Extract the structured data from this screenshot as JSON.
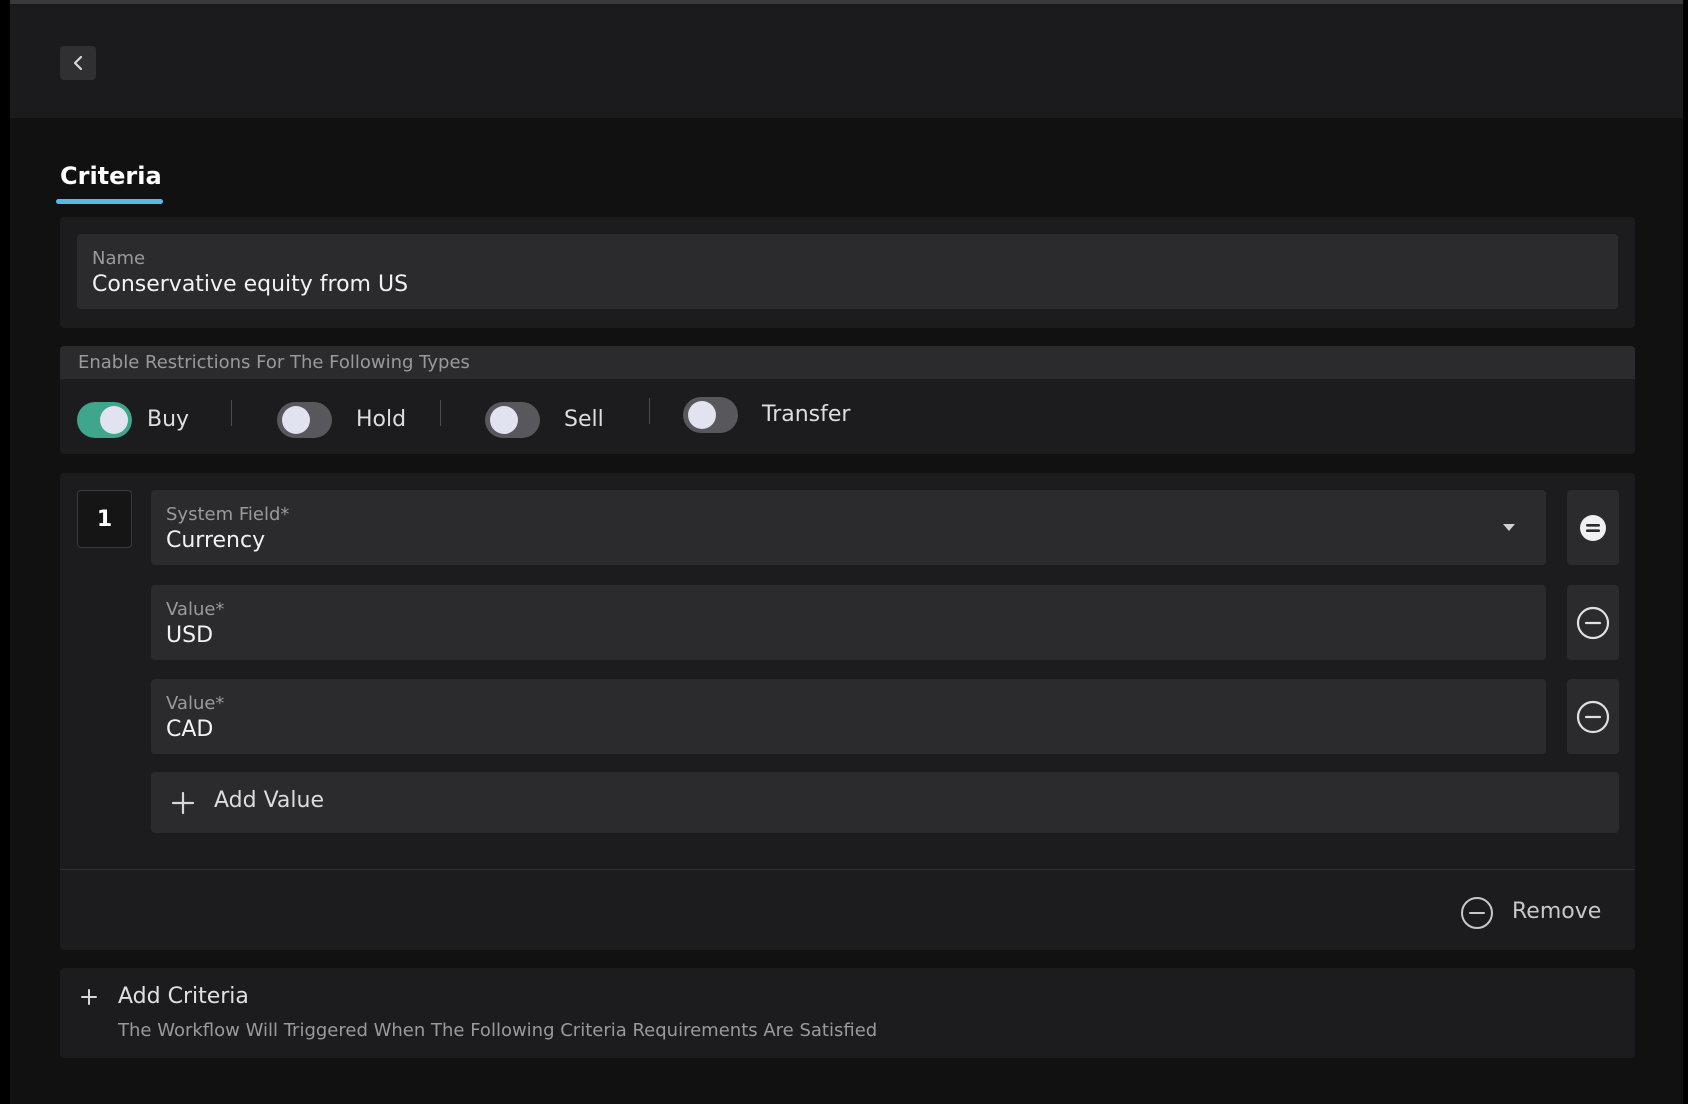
{
  "header": {
    "back_icon": "chevron-left-icon"
  },
  "tabs": [
    {
      "label": "Criteria",
      "active": true
    }
  ],
  "name_field": {
    "label": "Name",
    "value": "Conservative equity from US"
  },
  "restrictions": {
    "heading": "Enable Restrictions For The Following Types",
    "toggles": [
      {
        "label": "Buy",
        "enabled": true
      },
      {
        "label": "Hold",
        "enabled": false
      },
      {
        "label": "Sell",
        "enabled": false
      },
      {
        "label": "Transfer",
        "enabled": false
      }
    ]
  },
  "criteria": [
    {
      "index": "1",
      "system_field": {
        "label": "System Field*",
        "value": "Currency"
      },
      "values": [
        {
          "label": "Value*",
          "value": "USD"
        },
        {
          "label": "Value*",
          "value": "CAD"
        }
      ],
      "add_value_label": "Add Value",
      "remove_label": "Remove"
    }
  ],
  "add_criteria": {
    "label": "Add Criteria",
    "description": "The Workflow Will Triggered When The Following Criteria Requirements Are Satisfied"
  },
  "colors": {
    "accent": "#5bb8e6",
    "toggle_on": "#3fa58b"
  }
}
